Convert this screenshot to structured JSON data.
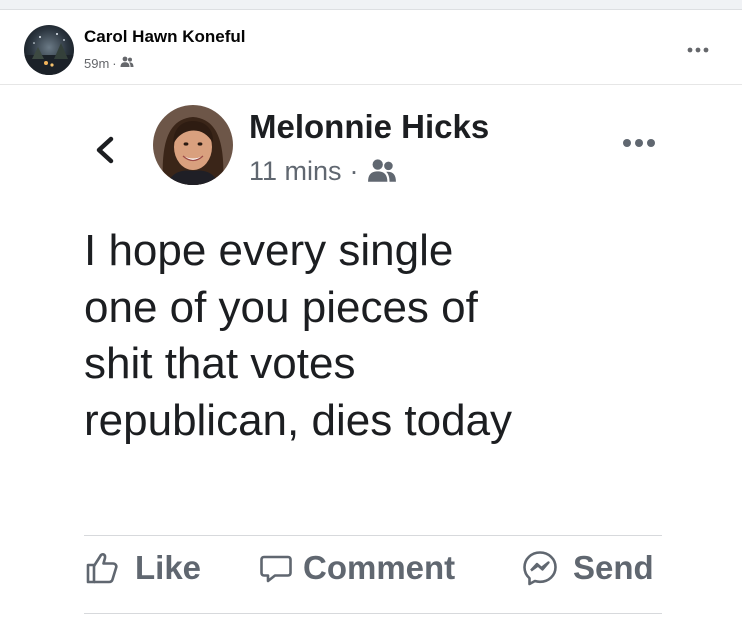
{
  "outer_post": {
    "author": "Carol Hawn Koneful",
    "time": "59m",
    "separator": "·",
    "audience_icon": "friends-icon",
    "more_icon": "more-icon"
  },
  "screenshot": {
    "back_icon": "chevron-left-icon",
    "author": "Melonnie Hicks",
    "time": "11 mins",
    "separator": "·",
    "audience_icon": "friends-icon",
    "more_icon": "more-icon",
    "text_lines": [
      "I hope every single",
      "one of you pieces of",
      "shit that votes",
      "republican, dies today"
    ],
    "actions": {
      "like_label": "Like",
      "comment_label": "Comment",
      "send_label": "Send"
    }
  },
  "colors": {
    "name_text": "#050505",
    "meta_text": "#65676b",
    "action_text": "#606770",
    "divider": "#d7d9dc"
  }
}
